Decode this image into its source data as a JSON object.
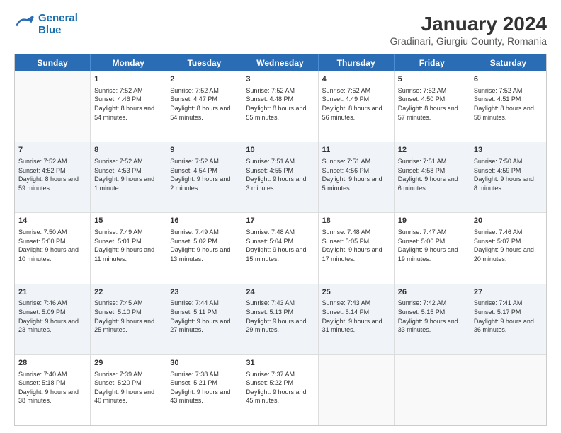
{
  "header": {
    "logo_line1": "General",
    "logo_line2": "Blue",
    "main_title": "January 2024",
    "subtitle": "Gradinari, Giurgiu County, Romania"
  },
  "days_of_week": [
    "Sunday",
    "Monday",
    "Tuesday",
    "Wednesday",
    "Thursday",
    "Friday",
    "Saturday"
  ],
  "weeks": [
    [
      {
        "day": "",
        "sunrise": "",
        "sunset": "",
        "daylight": ""
      },
      {
        "day": "1",
        "sunrise": "Sunrise: 7:52 AM",
        "sunset": "Sunset: 4:46 PM",
        "daylight": "Daylight: 8 hours and 54 minutes."
      },
      {
        "day": "2",
        "sunrise": "Sunrise: 7:52 AM",
        "sunset": "Sunset: 4:47 PM",
        "daylight": "Daylight: 8 hours and 54 minutes."
      },
      {
        "day": "3",
        "sunrise": "Sunrise: 7:52 AM",
        "sunset": "Sunset: 4:48 PM",
        "daylight": "Daylight: 8 hours and 55 minutes."
      },
      {
        "day": "4",
        "sunrise": "Sunrise: 7:52 AM",
        "sunset": "Sunset: 4:49 PM",
        "daylight": "Daylight: 8 hours and 56 minutes."
      },
      {
        "day": "5",
        "sunrise": "Sunrise: 7:52 AM",
        "sunset": "Sunset: 4:50 PM",
        "daylight": "Daylight: 8 hours and 57 minutes."
      },
      {
        "day": "6",
        "sunrise": "Sunrise: 7:52 AM",
        "sunset": "Sunset: 4:51 PM",
        "daylight": "Daylight: 8 hours and 58 minutes."
      }
    ],
    [
      {
        "day": "7",
        "sunrise": "Sunrise: 7:52 AM",
        "sunset": "Sunset: 4:52 PM",
        "daylight": "Daylight: 8 hours and 59 minutes."
      },
      {
        "day": "8",
        "sunrise": "Sunrise: 7:52 AM",
        "sunset": "Sunset: 4:53 PM",
        "daylight": "Daylight: 9 hours and 1 minute."
      },
      {
        "day": "9",
        "sunrise": "Sunrise: 7:52 AM",
        "sunset": "Sunset: 4:54 PM",
        "daylight": "Daylight: 9 hours and 2 minutes."
      },
      {
        "day": "10",
        "sunrise": "Sunrise: 7:51 AM",
        "sunset": "Sunset: 4:55 PM",
        "daylight": "Daylight: 9 hours and 3 minutes."
      },
      {
        "day": "11",
        "sunrise": "Sunrise: 7:51 AM",
        "sunset": "Sunset: 4:56 PM",
        "daylight": "Daylight: 9 hours and 5 minutes."
      },
      {
        "day": "12",
        "sunrise": "Sunrise: 7:51 AM",
        "sunset": "Sunset: 4:58 PM",
        "daylight": "Daylight: 9 hours and 6 minutes."
      },
      {
        "day": "13",
        "sunrise": "Sunrise: 7:50 AM",
        "sunset": "Sunset: 4:59 PM",
        "daylight": "Daylight: 9 hours and 8 minutes."
      }
    ],
    [
      {
        "day": "14",
        "sunrise": "Sunrise: 7:50 AM",
        "sunset": "Sunset: 5:00 PM",
        "daylight": "Daylight: 9 hours and 10 minutes."
      },
      {
        "day": "15",
        "sunrise": "Sunrise: 7:49 AM",
        "sunset": "Sunset: 5:01 PM",
        "daylight": "Daylight: 9 hours and 11 minutes."
      },
      {
        "day": "16",
        "sunrise": "Sunrise: 7:49 AM",
        "sunset": "Sunset: 5:02 PM",
        "daylight": "Daylight: 9 hours and 13 minutes."
      },
      {
        "day": "17",
        "sunrise": "Sunrise: 7:48 AM",
        "sunset": "Sunset: 5:04 PM",
        "daylight": "Daylight: 9 hours and 15 minutes."
      },
      {
        "day": "18",
        "sunrise": "Sunrise: 7:48 AM",
        "sunset": "Sunset: 5:05 PM",
        "daylight": "Daylight: 9 hours and 17 minutes."
      },
      {
        "day": "19",
        "sunrise": "Sunrise: 7:47 AM",
        "sunset": "Sunset: 5:06 PM",
        "daylight": "Daylight: 9 hours and 19 minutes."
      },
      {
        "day": "20",
        "sunrise": "Sunrise: 7:46 AM",
        "sunset": "Sunset: 5:07 PM",
        "daylight": "Daylight: 9 hours and 20 minutes."
      }
    ],
    [
      {
        "day": "21",
        "sunrise": "Sunrise: 7:46 AM",
        "sunset": "Sunset: 5:09 PM",
        "daylight": "Daylight: 9 hours and 23 minutes."
      },
      {
        "day": "22",
        "sunrise": "Sunrise: 7:45 AM",
        "sunset": "Sunset: 5:10 PM",
        "daylight": "Daylight: 9 hours and 25 minutes."
      },
      {
        "day": "23",
        "sunrise": "Sunrise: 7:44 AM",
        "sunset": "Sunset: 5:11 PM",
        "daylight": "Daylight: 9 hours and 27 minutes."
      },
      {
        "day": "24",
        "sunrise": "Sunrise: 7:43 AM",
        "sunset": "Sunset: 5:13 PM",
        "daylight": "Daylight: 9 hours and 29 minutes."
      },
      {
        "day": "25",
        "sunrise": "Sunrise: 7:43 AM",
        "sunset": "Sunset: 5:14 PM",
        "daylight": "Daylight: 9 hours and 31 minutes."
      },
      {
        "day": "26",
        "sunrise": "Sunrise: 7:42 AM",
        "sunset": "Sunset: 5:15 PM",
        "daylight": "Daylight: 9 hours and 33 minutes."
      },
      {
        "day": "27",
        "sunrise": "Sunrise: 7:41 AM",
        "sunset": "Sunset: 5:17 PM",
        "daylight": "Daylight: 9 hours and 36 minutes."
      }
    ],
    [
      {
        "day": "28",
        "sunrise": "Sunrise: 7:40 AM",
        "sunset": "Sunset: 5:18 PM",
        "daylight": "Daylight: 9 hours and 38 minutes."
      },
      {
        "day": "29",
        "sunrise": "Sunrise: 7:39 AM",
        "sunset": "Sunset: 5:20 PM",
        "daylight": "Daylight: 9 hours and 40 minutes."
      },
      {
        "day": "30",
        "sunrise": "Sunrise: 7:38 AM",
        "sunset": "Sunset: 5:21 PM",
        "daylight": "Daylight: 9 hours and 43 minutes."
      },
      {
        "day": "31",
        "sunrise": "Sunrise: 7:37 AM",
        "sunset": "Sunset: 5:22 PM",
        "daylight": "Daylight: 9 hours and 45 minutes."
      },
      {
        "day": "",
        "sunrise": "",
        "sunset": "",
        "daylight": ""
      },
      {
        "day": "",
        "sunrise": "",
        "sunset": "",
        "daylight": ""
      },
      {
        "day": "",
        "sunrise": "",
        "sunset": "",
        "daylight": ""
      }
    ]
  ]
}
